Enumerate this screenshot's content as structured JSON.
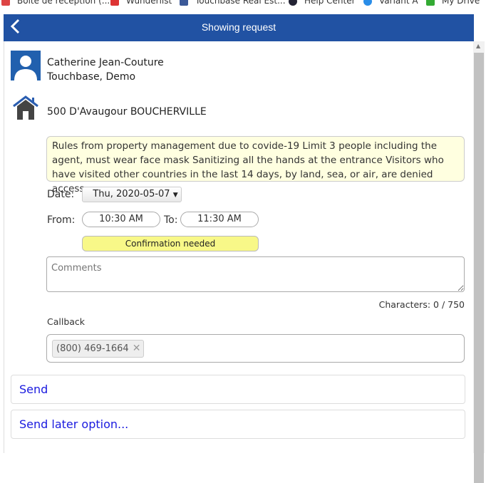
{
  "bookmarks": [
    "Boîte de réception (...",
    "Wunderlist",
    "Touchbase Real Est...",
    "Help Center",
    "Variant A",
    "My Drive"
  ],
  "header": {
    "back_icon": "chevron-left-icon",
    "title": "Showing request"
  },
  "contact": {
    "name": "Catherine Jean-Couture",
    "company": "Touchbase, Demo"
  },
  "property": {
    "address": "500 D'Avaugour BOUCHERVILLE"
  },
  "rules": "Rules from property management due to covide-19 Limit 3 people including the agent, must wear face mask Sanitizing all the hands at the entrance Visitors who have visited other countries in the last 14 days, by land, sea, or air, are denied access",
  "form": {
    "date_label": "Date:",
    "date_value": "Thu, 2020-05-07",
    "from_label": "From:",
    "from_value": "10:30 AM",
    "to_label": "To:",
    "to_value": "11:30 AM",
    "status": "Confirmation needed",
    "comments_placeholder": "Comments",
    "char_count": "Characters: 0 / 750",
    "callback_label": "Callback",
    "callback_value": "(800) 469-1664"
  },
  "actions": {
    "send": "Send",
    "send_later": "Send later option..."
  },
  "colors": {
    "header": "#2152a3",
    "status": "#f8f888",
    "link": "#1a1adf"
  }
}
